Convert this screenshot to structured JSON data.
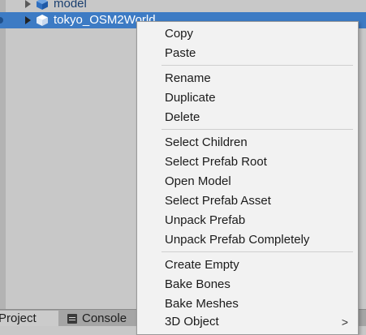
{
  "hierarchy": {
    "items": [
      {
        "label": "model",
        "selected": false
      },
      {
        "label": "tokyo_OSM2World",
        "selected": true
      }
    ]
  },
  "tabs": [
    {
      "label": "Project",
      "icon": "project-icon"
    },
    {
      "label": "Console",
      "icon": "console-icon"
    }
  ],
  "context_menu": {
    "groups": [
      [
        "Copy",
        "Paste"
      ],
      [
        "Rename",
        "Duplicate",
        "Delete"
      ],
      [
        "Select Children",
        "Select Prefab Root",
        "Open Model",
        "Select Prefab Asset",
        "Unpack Prefab",
        "Unpack Prefab Completely"
      ],
      [
        "Create Empty",
        "Bake Bones",
        "Bake Meshes",
        "3D Object"
      ]
    ],
    "submenu_indicator": ">"
  },
  "colors": {
    "selection": "#3d7bc4",
    "menu_bg": "#f2f2f2",
    "panel_bg": "#c8c8c8"
  }
}
